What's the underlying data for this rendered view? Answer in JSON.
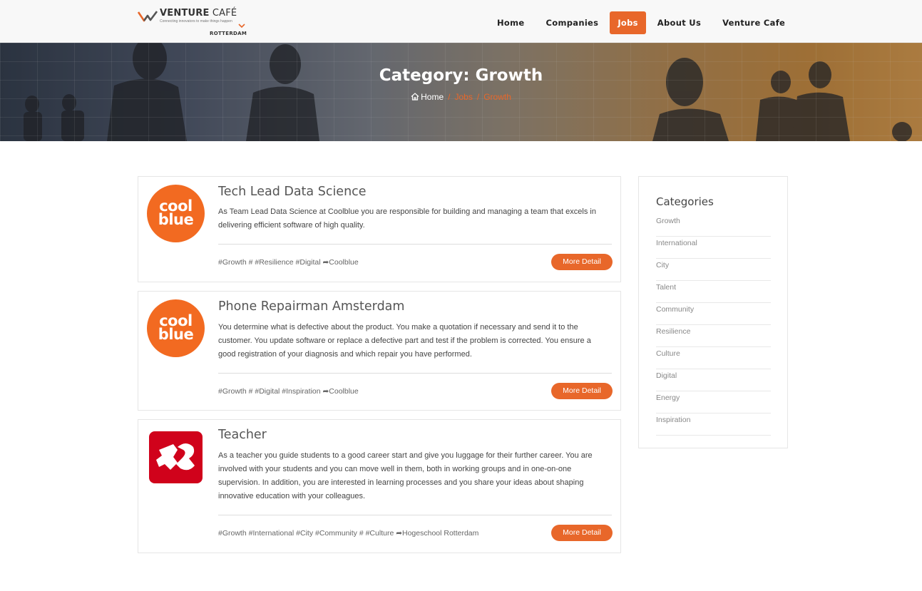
{
  "header": {
    "logo": {
      "name_bold": "VENTURE",
      "name_light": " CAFÉ",
      "tagline": "Connecting innovators to make things happen",
      "city": "ROTTERDAM"
    },
    "nav": [
      "Home",
      "Companies",
      "Jobs",
      "About Us",
      "Venture Cafe"
    ],
    "active_nav": "Jobs"
  },
  "banner": {
    "title": "Category: Growth",
    "breadcrumbs": [
      "Home",
      "Jobs",
      "Growth"
    ]
  },
  "jobs": [
    {
      "title": "Tech Lead Data Science",
      "logo": "coolblue-logo",
      "logo_text": [
        "cool",
        "blue"
      ],
      "description": "As Team Lead Data Science at Coolblue you are responsible for building and managing a team that excels in delivering efficient software of high quality.",
      "tags": "#Growth # #Resilience #Digital ➦Coolblue",
      "button": "More Detail"
    },
    {
      "title": "Phone Repairman Amsterdam",
      "logo": "coolblue-logo",
      "logo_text": [
        "cool",
        "blue"
      ],
      "description": "You determine what is defective about the product. You make a quotation if necessary and send it to the customer. You update software or replace a defective part and test if the problem is corrected. You ensure a good registration of your diagnosis and which repair you have performed.",
      "tags": "#Growth # #Digital #Inspiration ➦Coolblue",
      "button": "More Detail"
    },
    {
      "title": "Teacher",
      "logo": "hogeschool-rotterdam-logo",
      "description": "As a teacher you guide students to a good career start and give you luggage for their further career. You are involved with your students and you can move well in them, both in working groups and in one-on-one supervision. In addition, you are interested in learning processes and you share your ideas about shaping innovative education with your colleagues.",
      "tags": "#Growth #International #City #Community # #Culture ➦Hogeschool Rotterdam",
      "button": "More Detail"
    }
  ],
  "sidebar": {
    "title": "Categories",
    "categories": [
      "Growth",
      "International",
      "City",
      "Talent",
      "Community",
      "Resilience",
      "Culture",
      "Digital",
      "Energy",
      "Inspiration"
    ]
  },
  "colors": {
    "accent": "#e8672a",
    "coolblue": "#f26a21",
    "hogeschool": "#d0021b"
  }
}
